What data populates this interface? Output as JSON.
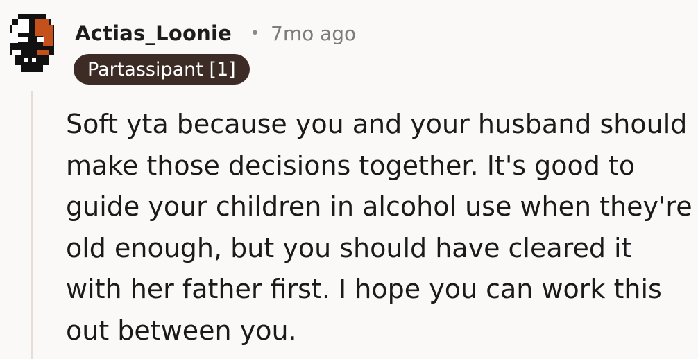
{
  "comment": {
    "avatar_icon": "pixel-skull-avatar-icon",
    "author": "Actias_Loonie",
    "separator": "•",
    "time_ago": "7mo ago",
    "flair": "Partassipant [1]",
    "body": "Soft yta because you and your husband should make those decisions together. It's good to guide your children in alcohol use when they're old enough, but you should have cleared it with her father first. I hope you can work this out between you."
  },
  "colors": {
    "background": "#fbf9f8",
    "flair_bg": "#3d2c26",
    "thread_line": "#e7dcd6",
    "avatar_orange": "#c4501c"
  }
}
